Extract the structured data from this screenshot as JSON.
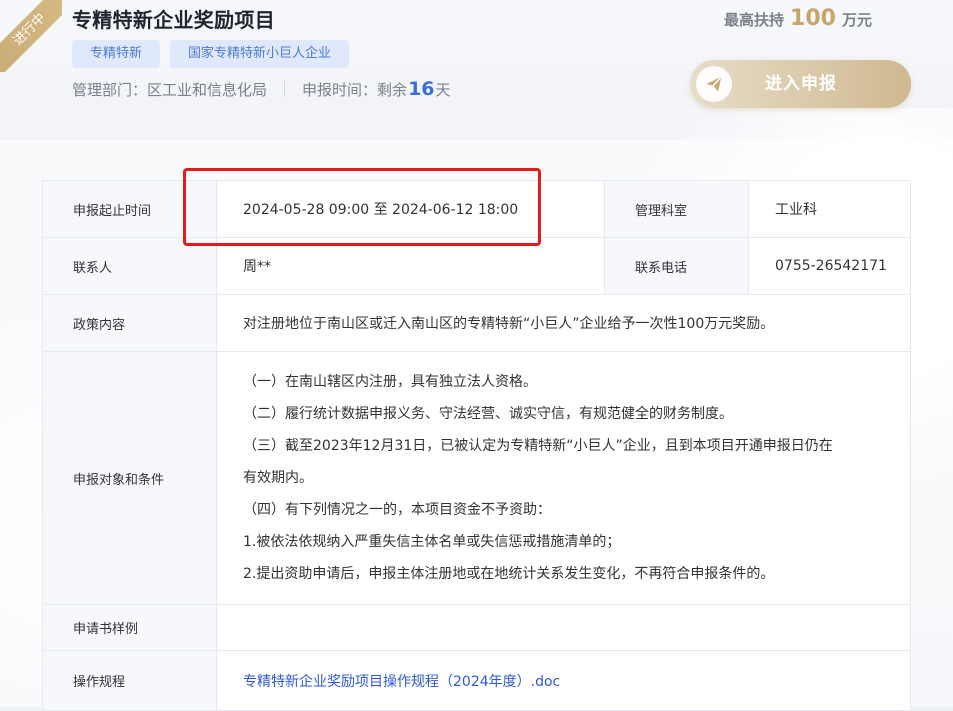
{
  "header": {
    "status_badge": "进行中",
    "title": "专精特新企业奖励项目",
    "tags": [
      "专精特新",
      "国家专精特新小巨人企业"
    ],
    "management_label": "管理部门：",
    "management_dept": "区工业和信息化局",
    "deadline_label": "申报时间：",
    "deadline_prefix": "剩余",
    "deadline_days": "16",
    "deadline_suffix": "天",
    "max_support_label": "最高扶持",
    "max_support_amount": "100",
    "max_support_unit": "万元",
    "apply_button": "进入申报"
  },
  "details": {
    "period_label": "申报起止时间",
    "period_value": "2024-05-28 09:00 至 2024-06-12 18:00",
    "office_label": "管理科室",
    "office_value": "工业科",
    "contact_label": "联系人",
    "contact_value": "周**",
    "phone_label": "联系电话",
    "phone_value": "0755-26542171",
    "policy_label": "政策内容",
    "policy_value": "对注册地位于南山区或迁入南山区的专精特新“小巨人”企业给予一次性100万元奖励。",
    "conditions_label": "申报对象和条件",
    "conditions": [
      "（一）在南山辖区内注册，具有独立法人资格。",
      "（二）履行统计数据申报义务、守法经营、诚实守信，有规范健全的财务制度。",
      "（三）截至2023年12月31日，已被认定为专精特新“小巨人”企业，且到本项目开通申报日仍在",
      "有效期内。",
      "（四）有下列情况之一的，本项目资金不予资助：",
      "1.被依法依规纳入严重失信主体名单或失信惩戒措施清单的；",
      "2.提出资助申请后，申报主体注册地或在地统计关系发生变化，不再符合申报条件的。"
    ],
    "sample_label": "申请书样例",
    "sample_value": "",
    "procedure_label": "操作规程",
    "procedure_link": "专精特新企业奖励项目操作规程（2024年度）.doc"
  },
  "colors": {
    "accent_gold": "#c7a56a",
    "accent_blue": "#3a6fd8",
    "highlight_red": "#e61a1a"
  }
}
